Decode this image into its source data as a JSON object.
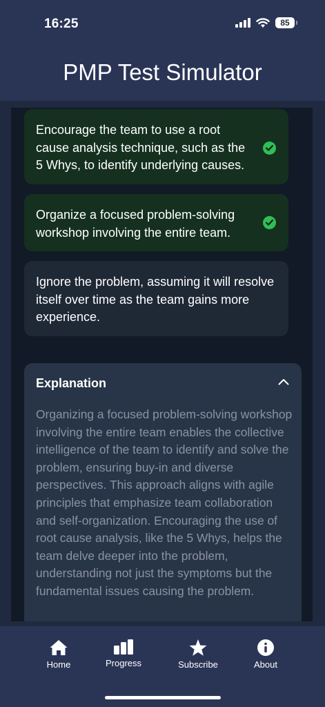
{
  "status_bar": {
    "time": "16:25",
    "battery": "85"
  },
  "header": {
    "title": "PMP Test Simulator"
  },
  "options": [
    {
      "text": "Encourage the team to use a root cause analysis technique, such as the 5 Whys, to identify underlying causes.",
      "state": "correct"
    },
    {
      "text": "Organize a focused problem-solving workshop involving the entire team.",
      "state": "correct"
    },
    {
      "text": "Ignore the problem, assuming it will resolve itself over time as the team gains more experience.",
      "state": "neutral"
    }
  ],
  "explanation": {
    "title": "Explanation",
    "expanded": true,
    "body": "Organizing a focused problem-solving workshop involving the entire team enables the collective intelligence of the team to identify and solve the problem, ensuring buy-in and diverse perspectives. This approach aligns with agile principles that emphasize team collaboration and self-organization. Encouraging the use of root cause analysis, like the 5 Whys, helps the team delve deeper into the problem, understanding not just the symptoms but the fundamental issues causing the problem."
  },
  "tabs": [
    {
      "label": "Home",
      "icon": "home-icon"
    },
    {
      "label": "Progress",
      "icon": "bar-chart-icon"
    },
    {
      "label": "Subscribe",
      "icon": "star-icon"
    },
    {
      "label": "About",
      "icon": "info-icon"
    }
  ],
  "colors": {
    "header_bg": "#2a3556",
    "correct_bg": "#15301f",
    "check_green": "#2fbf55",
    "explanation_bg": "#283447"
  }
}
